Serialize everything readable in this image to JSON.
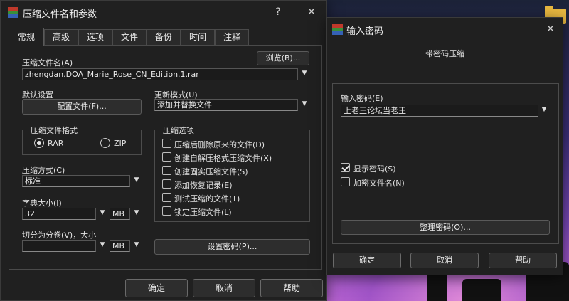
{
  "colors": {
    "dialog_bg": "#202020",
    "border": "#4a4a4a",
    "text": "#e6e6e6",
    "winrar_red": "#c0392b",
    "winrar_green": "#3a8f3a",
    "winrar_blue": "#3561b5"
  },
  "main_dialog": {
    "title": "压缩文件名和参数",
    "help_symbol": "?",
    "close_symbol": "✕",
    "tabs": [
      "常规",
      "高级",
      "选项",
      "文件",
      "备份",
      "时间",
      "注释"
    ],
    "archive_name_label": "压缩文件名(A)",
    "browse_label": "浏览(B)...",
    "archive_name_value": "zhengdan.DOA_Marie_Rose_CN_Edition.1.rar",
    "default_settings_label": "默认设置",
    "profiles_label": "配置文件(F)...",
    "update_mode_label": "更新模式(U)",
    "update_mode_value": "添加并替换文件",
    "format_group_title": "压缩文件格式",
    "format_rar": "RAR",
    "format_zip": "ZIP",
    "method_label": "压缩方式(C)",
    "method_value": "标准",
    "dict_label": "字典大小(I)",
    "dict_value": "32",
    "dict_unit": "MB",
    "split_label": "切分为分卷(V)，大小",
    "split_value": "",
    "split_unit": "MB",
    "options_group_title": "压缩选项",
    "options": [
      "压缩后删除原来的文件(D)",
      "创建自解压格式压缩文件(X)",
      "创建固实压缩文件(S)",
      "添加恢复记录(E)",
      "测试压缩的文件(T)",
      "锁定压缩文件(L)"
    ],
    "set_password_label": "设置密码(P)...",
    "ok_label": "确定",
    "cancel_label": "取消",
    "help_label": "帮助"
  },
  "password_dialog": {
    "title": "输入密码",
    "close_symbol": "✕",
    "subtitle": "带密码压缩",
    "enter_password_label": "输入密码(E)",
    "password_value": "上老王论坛当老王",
    "show_password_label": "显示密码(S)",
    "show_password_checked": true,
    "encrypt_names_label": "加密文件名(N)",
    "encrypt_names_checked": false,
    "organize_label": "整理密码(O)...",
    "ok_label": "确定",
    "cancel_label": "取消",
    "help_label": "帮助"
  }
}
